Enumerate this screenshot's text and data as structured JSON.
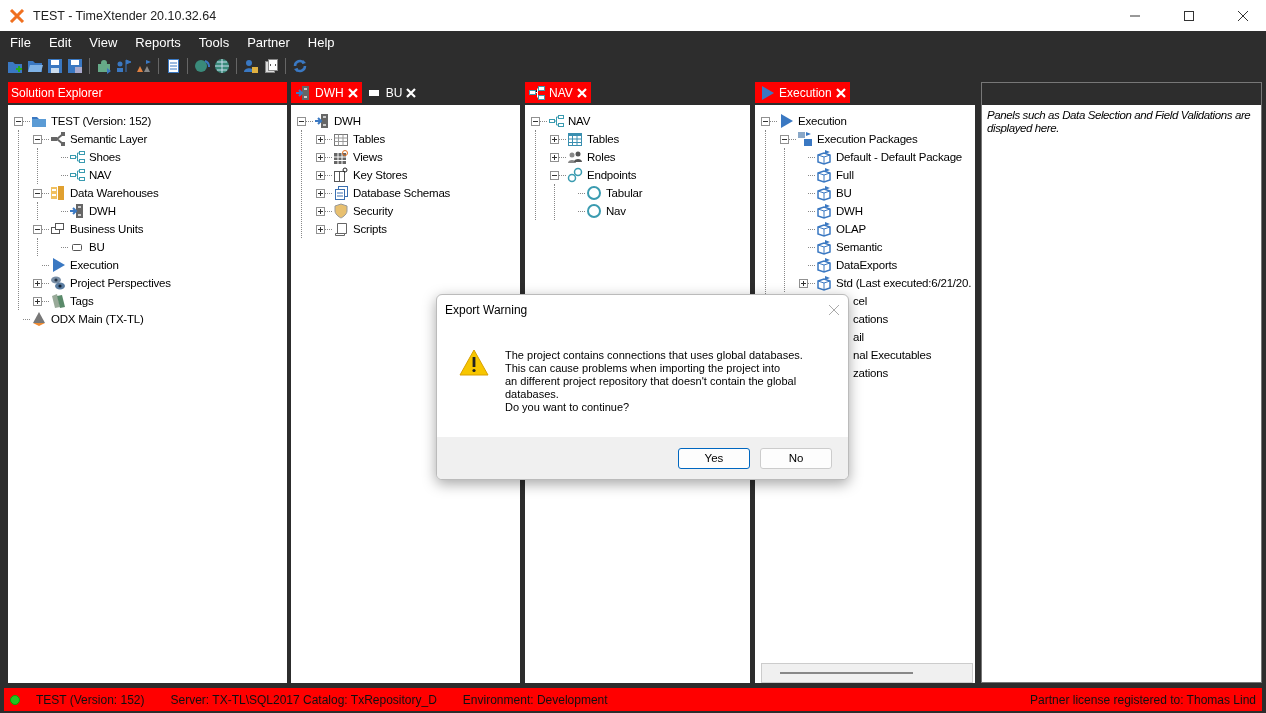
{
  "window": {
    "title": "TEST - TimeXtender 20.10.32.64"
  },
  "menu": [
    "File",
    "Edit",
    "View",
    "Reports",
    "Tools",
    "Partner",
    "Help"
  ],
  "panels": [
    {
      "tabs": [
        {
          "label": "Solution Explorer",
          "kind": "header",
          "selected": true
        }
      ],
      "tree": [
        {
          "label": "TEST (Version: 152)",
          "kind": "folder",
          "expanded": true,
          "children": [
            {
              "label": "Semantic Layer",
              "kind": "semantic",
              "expanded": true,
              "children": [
                {
                  "label": "Shoes",
                  "kind": "model"
                },
                {
                  "label": "NAV",
                  "kind": "model"
                }
              ]
            },
            {
              "label": "Data Warehouses",
              "kind": "warehouse",
              "expanded": true,
              "children": [
                {
                  "label": "DWH",
                  "kind": "dwh"
                }
              ]
            },
            {
              "label": "Business Units",
              "kind": "business",
              "expanded": true,
              "children": [
                {
                  "label": "BU",
                  "kind": "bu"
                }
              ]
            },
            {
              "label": "Execution",
              "kind": "execution"
            },
            {
              "label": "Project Perspectives",
              "kind": "perspective",
              "expanded": false
            },
            {
              "label": "Tags",
              "kind": "tags",
              "expanded": false
            }
          ]
        },
        {
          "label": "ODX Main (TX-TL)",
          "kind": "odx"
        }
      ]
    },
    {
      "tabs": [
        {
          "label": "DWH",
          "kind": "dwh",
          "selected": true
        },
        {
          "label": "BU",
          "kind": "bu",
          "selected": false
        }
      ],
      "tree": [
        {
          "label": "DWH",
          "kind": "dwh",
          "expanded": true,
          "children": [
            {
              "label": "Tables",
              "kind": "table",
              "expanded": false
            },
            {
              "label": "Views",
              "kind": "view",
              "expanded": false
            },
            {
              "label": "Key Stores",
              "kind": "keystore",
              "expanded": false
            },
            {
              "label": "Database Schemas",
              "kind": "schema",
              "expanded": false
            },
            {
              "label": "Security",
              "kind": "security",
              "expanded": false
            },
            {
              "label": "Scripts",
              "kind": "script",
              "expanded": false
            }
          ]
        }
      ]
    },
    {
      "tabs": [
        {
          "label": "NAV",
          "kind": "model",
          "selected": true
        }
      ],
      "tree": [
        {
          "label": "NAV",
          "kind": "model",
          "expanded": true,
          "children": [
            {
              "label": "Tables",
              "kind": "table2",
              "expanded": false
            },
            {
              "label": "Roles",
              "kind": "roles",
              "expanded": false
            },
            {
              "label": "Endpoints",
              "kind": "endpoints",
              "expanded": true,
              "children": [
                {
                  "label": "Tabular",
                  "kind": "endpoint"
                },
                {
                  "label": "Nav",
                  "kind": "endpoint"
                }
              ]
            }
          ]
        }
      ]
    },
    {
      "tabs": [
        {
          "label": "Execution",
          "kind": "execution",
          "selected": true
        }
      ],
      "scrollbar": true,
      "tree": [
        {
          "label": "Execution",
          "kind": "execution",
          "expanded": true,
          "children": [
            {
              "label": "Execution Packages",
              "kind": "packages",
              "expanded": true,
              "children": [
                {
                  "label": "Default - Default Package",
                  "kind": "package"
                },
                {
                  "label": "Full",
                  "kind": "package"
                },
                {
                  "label": "BU",
                  "kind": "package"
                },
                {
                  "label": "DWH",
                  "kind": "package"
                },
                {
                  "label": "OLAP",
                  "kind": "package"
                },
                {
                  "label": "Semantic",
                  "kind": "package"
                },
                {
                  "label": "DataExports",
                  "kind": "package"
                },
                {
                  "label": "Std (Last executed:6/21/20.",
                  "kind": "package",
                  "expanded": false
                }
              ]
            },
            {
              "label": "cel",
              "kind": "covered"
            },
            {
              "label": "cations",
              "kind": "covered"
            },
            {
              "label": "ail",
              "kind": "covered"
            },
            {
              "label": "nal Executables",
              "kind": "covered"
            },
            {
              "label": "zations",
              "kind": "covered"
            }
          ]
        }
      ]
    }
  ],
  "info_panel": {
    "text": "Panels such as Data Selection and Field Validations are displayed here."
  },
  "dialog": {
    "title": "Export Warning",
    "message": "The project contains connections that uses global databases.\nThis can cause problems when importing the project into\nan different project repository that doesn't contain the global\ndatabases.\nDo you want to continue?",
    "buttons": [
      {
        "label": "Yes",
        "selected": true
      },
      {
        "label": "No",
        "selected": false
      }
    ]
  },
  "status_bar": {
    "connected": true,
    "items": [
      "TEST (Version: 152)",
      "Server: TX-TL\\SQL2017 Catalog: TxRepository_D",
      "Environment: Development"
    ],
    "license": "Partner license registered to: Thomas Lind"
  }
}
